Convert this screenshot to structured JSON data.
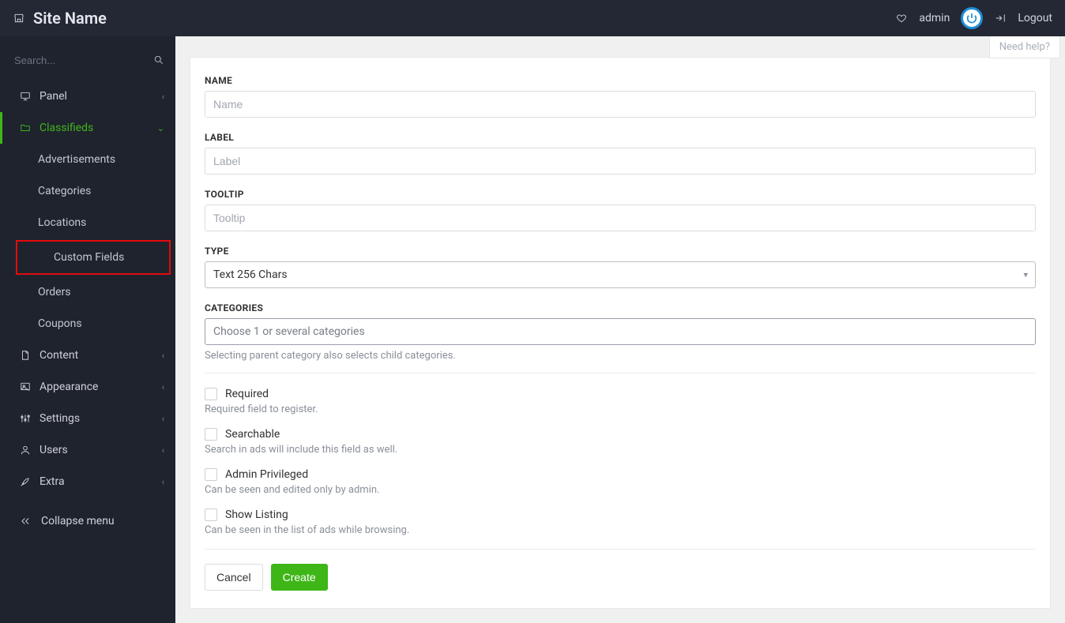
{
  "header": {
    "site_name": "Site Name",
    "username": "admin",
    "logout": "Logout",
    "need_help": "Need help?"
  },
  "sidebar": {
    "search_placeholder": "Search...",
    "items": [
      {
        "label": "Panel",
        "icon": "monitor-icon"
      },
      {
        "label": "Classifieds",
        "icon": "folder-icon",
        "active": true
      },
      {
        "label": "Content",
        "icon": "document-icon"
      },
      {
        "label": "Appearance",
        "icon": "image-icon"
      },
      {
        "label": "Settings",
        "icon": "sliders-icon"
      },
      {
        "label": "Users",
        "icon": "user-icon"
      },
      {
        "label": "Extra",
        "icon": "rocket-icon"
      }
    ],
    "classifieds_sub": [
      {
        "label": "Advertisements"
      },
      {
        "label": "Categories"
      },
      {
        "label": "Locations"
      },
      {
        "label": "Custom Fields",
        "highlight": true
      },
      {
        "label": "Orders"
      },
      {
        "label": "Coupons"
      }
    ],
    "collapse": "Collapse menu"
  },
  "form": {
    "name_label": "NAME",
    "name_placeholder": "Name",
    "label_label": "LABEL",
    "label_placeholder": "Label",
    "tooltip_label": "TOOLTIP",
    "tooltip_placeholder": "Tooltip",
    "type_label": "TYPE",
    "type_selected": "Text 256 Chars",
    "categories_label": "CATEGORIES",
    "categories_placeholder": "Choose 1 or several categories",
    "categories_help": "Selecting parent category also selects child categories.",
    "checks": [
      {
        "label": "Required",
        "help": "Required field to register."
      },
      {
        "label": "Searchable",
        "help": "Search in ads will include this field as well."
      },
      {
        "label": "Admin Privileged",
        "help": "Can be seen and edited only by admin."
      },
      {
        "label": "Show Listing",
        "help": "Can be seen in the list of ads while browsing."
      }
    ],
    "cancel": "Cancel",
    "create": "Create"
  }
}
